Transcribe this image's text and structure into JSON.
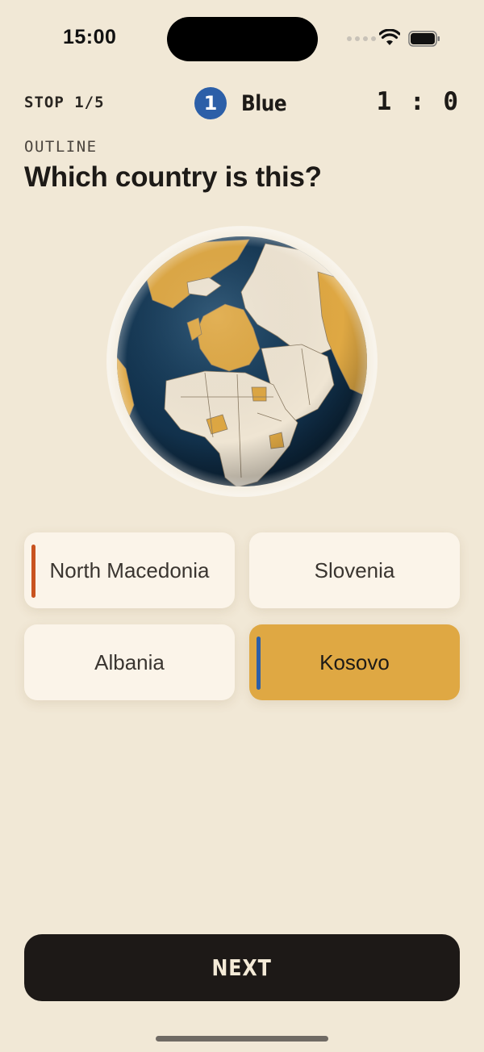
{
  "status_bar": {
    "time": "15:00"
  },
  "header": {
    "stop_label": "STOP 1/5",
    "player_number": "1",
    "player_name": "Blue",
    "score": "1 : 0"
  },
  "question": {
    "category": "OUTLINE",
    "text": "Which country is this?"
  },
  "answers": [
    {
      "label": "North Macedonia",
      "marker_color": "#c9531f",
      "selected": false
    },
    {
      "label": "Slovenia",
      "selected": false
    },
    {
      "label": "Albania",
      "selected": false
    },
    {
      "label": "Kosovo",
      "marker_color": "#2c5fa8",
      "selected": true
    }
  ],
  "next_button": {
    "label": "NEXT"
  },
  "colors": {
    "background": "#f1e8d6",
    "ocean": "#12324d",
    "land_highlight": "#dfa843",
    "land_neutral": "#efe5d3",
    "accent_blue": "#2c5fa8",
    "accent_orange": "#c9531f",
    "button_dark": "#1d1917"
  }
}
